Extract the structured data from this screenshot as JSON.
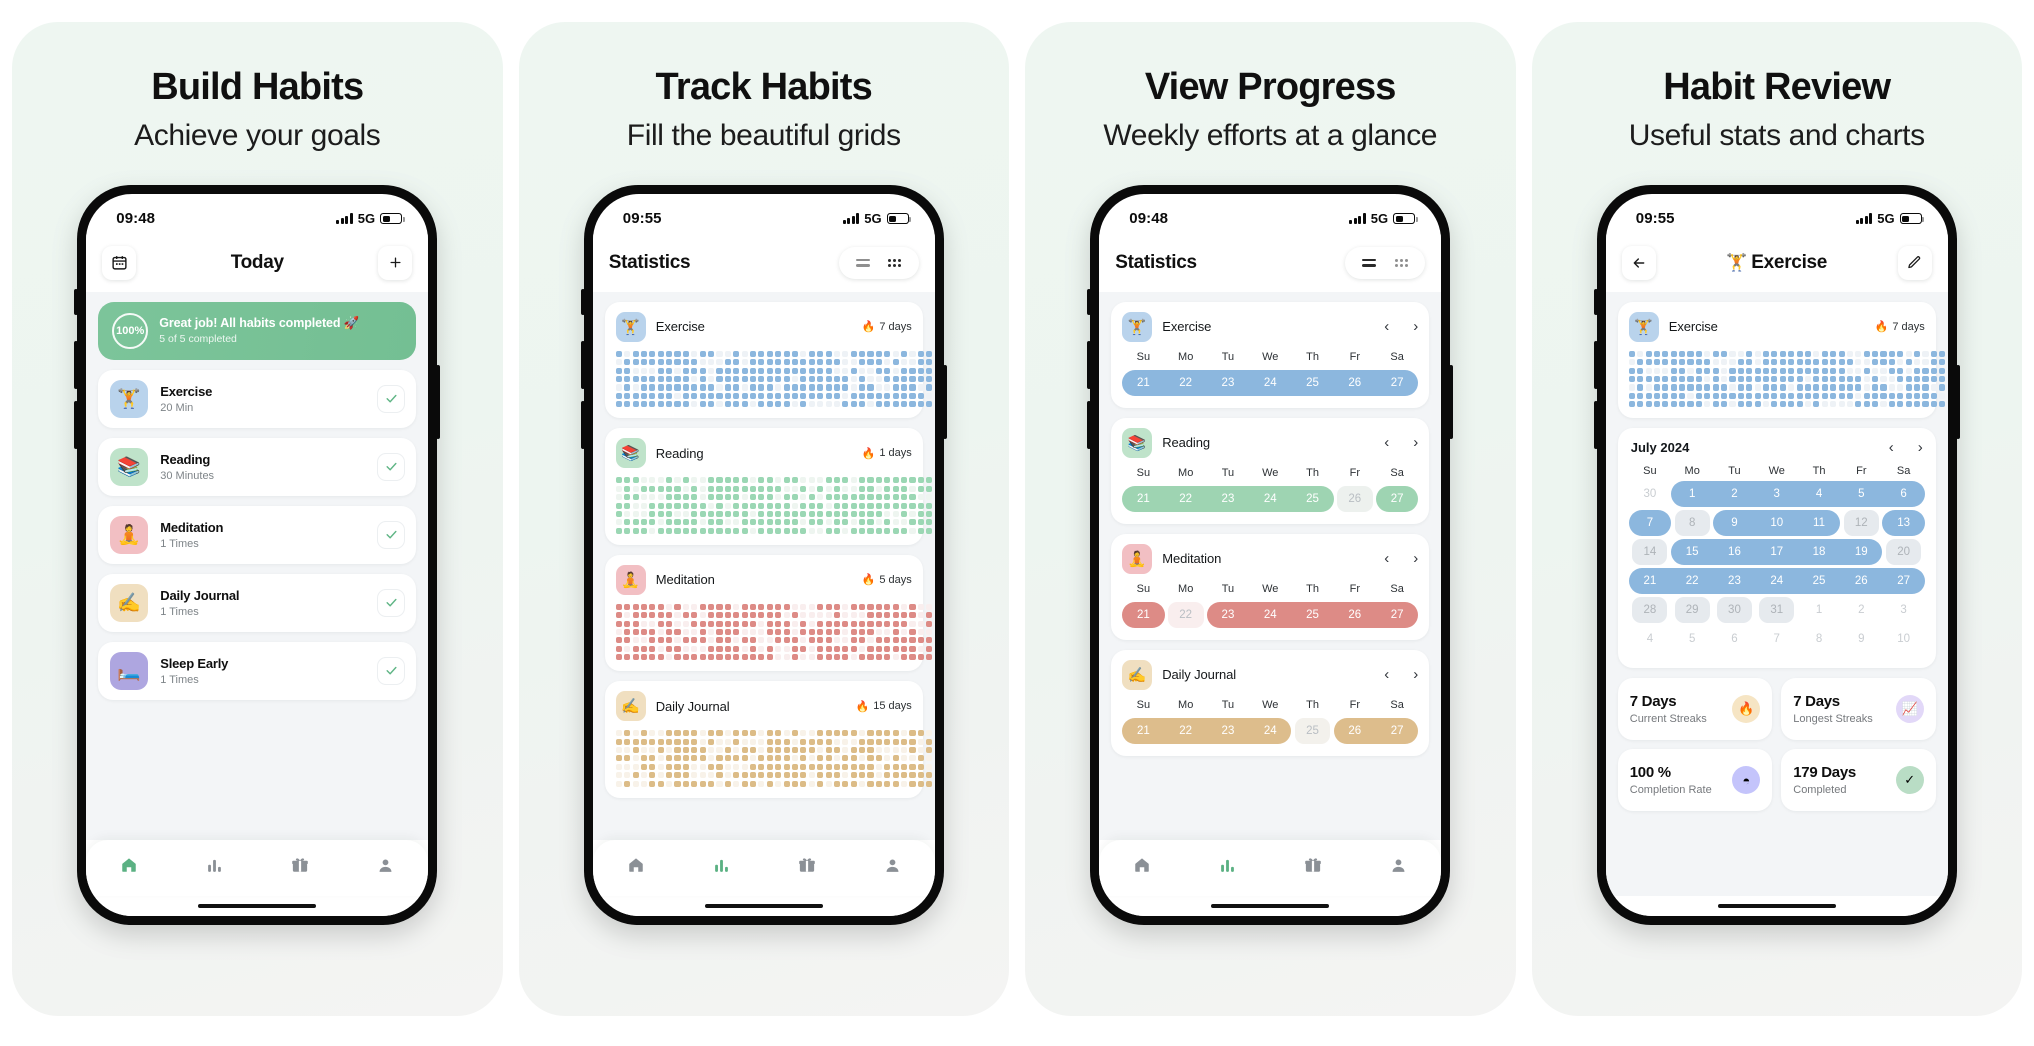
{
  "panels": [
    {
      "title": "Build Habits",
      "subtitle": "Achieve your goals"
    },
    {
      "title": "Track Habits",
      "subtitle": "Fill the beautiful grids"
    },
    {
      "title": "View Progress",
      "subtitle": "Weekly efforts at a glance"
    },
    {
      "title": "Habit Review",
      "subtitle": "Useful stats and charts"
    }
  ],
  "status": [
    {
      "time": "09:48",
      "network": "5G"
    },
    {
      "time": "09:55",
      "network": "5G"
    },
    {
      "time": "09:48",
      "network": "5G"
    },
    {
      "time": "09:55",
      "network": "5G"
    }
  ],
  "screen1": {
    "nav": {
      "title": "Today",
      "calendar_icon": "calendar-icon",
      "add_label": "+"
    },
    "summary": {
      "percent": "100%",
      "headline": "Great job! All habits completed 🚀",
      "sub": "5 of 5 completed"
    },
    "habits": [
      {
        "name": "Exercise",
        "goal": "20 Min",
        "emoji": "🏋️",
        "color": "#b9d3ec",
        "done": true
      },
      {
        "name": "Reading",
        "goal": "30 Minutes",
        "emoji": "📚",
        "color": "#bfe3ca",
        "done": true
      },
      {
        "name": "Meditation",
        "goal": "1 Times",
        "emoji": "🧘",
        "color": "#f2bfc3",
        "done": true
      },
      {
        "name": "Daily Journal",
        "goal": "1 Times",
        "emoji": "✍️",
        "color": "#f0dfc0",
        "done": true
      },
      {
        "name": "Sleep Early",
        "goal": "1 Times",
        "emoji": "🛏️",
        "color": "#aea6e0",
        "done": true
      }
    ],
    "tabs": [
      {
        "name": "home",
        "icon": "home-icon",
        "active": true
      },
      {
        "name": "stats",
        "icon": "chart-icon",
        "active": false
      },
      {
        "name": "rewards",
        "icon": "gift-icon",
        "active": false
      },
      {
        "name": "profile",
        "icon": "person-icon",
        "active": false
      }
    ]
  },
  "screen2": {
    "nav": {
      "title": "Statistics",
      "view_list": "list-view-icon",
      "view_grid": "grid-view-icon",
      "active_view": "grid"
    },
    "cards": [
      {
        "name": "Exercise",
        "emoji": "🏋️",
        "color": "#b9d3ec",
        "streak": "7 days",
        "fire": "🔥",
        "dot": "#8cb7de",
        "dim": "#eef2f6"
      },
      {
        "name": "Reading",
        "emoji": "📚",
        "color": "#bfe3ca",
        "streak": "1 days",
        "fire": "🔥",
        "dot": "#9bd7b4",
        "dim": "#eef5f0"
      },
      {
        "name": "Meditation",
        "emoji": "🧘",
        "color": "#f2bfc3",
        "streak": "5 days",
        "fire": "🔥",
        "dot": "#dd8b86",
        "dim": "#f9eeee"
      },
      {
        "name": "Daily Journal",
        "emoji": "✍️",
        "color": "#f0dfc0",
        "streak": "15 days",
        "fire": "🔥",
        "dot": "#dcbc87",
        "dim": "#f8f2e9"
      }
    ],
    "tabs": [
      {
        "name": "home",
        "icon": "home-icon",
        "active": false
      },
      {
        "name": "stats",
        "icon": "chart-icon",
        "active": true
      },
      {
        "name": "rewards",
        "icon": "gift-icon",
        "active": false
      },
      {
        "name": "profile",
        "icon": "person-icon",
        "active": false
      }
    ]
  },
  "screen3": {
    "nav": {
      "title": "Statistics",
      "view_list": "list-view-icon",
      "view_grid": "grid-view-icon",
      "active_view": "list"
    },
    "weekday_labels": [
      "Su",
      "Mo",
      "Tu",
      "We",
      "Th",
      "Fr",
      "Sa"
    ],
    "prev_label": "‹",
    "next_label": "›",
    "weeks": [
      {
        "name": "Exercise",
        "emoji": "🏋️",
        "color": "#b9d3ec",
        "fill": "#8cb7de",
        "faint": "#eef1f4",
        "days": [
          "21",
          "22",
          "23",
          "24",
          "25",
          "26",
          "27"
        ],
        "runs": [
          [
            0,
            6
          ]
        ],
        "faded": []
      },
      {
        "name": "Reading",
        "emoji": "📚",
        "color": "#bfe3ca",
        "fill": "#9ed4b2",
        "faint": "#edf1ee",
        "days": [
          "21",
          "22",
          "23",
          "24",
          "25",
          "26",
          "27"
        ],
        "runs": [
          [
            0,
            4
          ],
          [
            6,
            6
          ]
        ],
        "faded": [
          5
        ]
      },
      {
        "name": "Meditation",
        "emoji": "🧘",
        "color": "#f2bfc3",
        "fill": "#dd8b86",
        "faint": "#f9eeee",
        "days": [
          "21",
          "22",
          "23",
          "24",
          "25",
          "26",
          "27"
        ],
        "runs": [
          [
            0,
            0
          ],
          [
            2,
            6
          ]
        ],
        "faded": [
          1
        ]
      },
      {
        "name": "Daily Journal",
        "emoji": "✍️",
        "color": "#f0dfc0",
        "fill": "#ddbd8c",
        "faint": "#f3f1ec",
        "days": [
          "21",
          "22",
          "23",
          "24",
          "25",
          "26",
          "27"
        ],
        "runs": [
          [
            0,
            3
          ],
          [
            5,
            6
          ]
        ],
        "faded": [
          4
        ]
      }
    ],
    "tabs": [
      {
        "name": "home",
        "icon": "home-icon",
        "active": false
      },
      {
        "name": "stats",
        "icon": "chart-icon",
        "active": true
      },
      {
        "name": "rewards",
        "icon": "gift-icon",
        "active": false
      },
      {
        "name": "profile",
        "icon": "person-icon",
        "active": false
      }
    ]
  },
  "screen4": {
    "nav": {
      "back_icon": "back-arrow-icon",
      "title": "Exercise",
      "emoji": "🏋️",
      "edit_icon": "pencil-icon"
    },
    "heat_card": {
      "name": "Exercise",
      "emoji": "🏋️",
      "color": "#b9d3ec",
      "streak": "7 days",
      "fire": "🔥",
      "dot": "#8cb7de",
      "dim": "#eef2f6"
    },
    "calendar": {
      "month": "July 2024",
      "prev_label": "‹",
      "next_label": "›",
      "weekday_labels": [
        "Su",
        "Mo",
        "Tu",
        "We",
        "Th",
        "Fr",
        "Sa"
      ],
      "fill": "#8cb7de",
      "faint": "#e6eaee",
      "weeks": [
        {
          "days": [
            "30",
            "1",
            "2",
            "3",
            "4",
            "5",
            "6"
          ],
          "muted": [
            0
          ],
          "runs": [
            [
              1,
              6
            ]
          ],
          "faded": []
        },
        {
          "days": [
            "7",
            "8",
            "9",
            "10",
            "11",
            "12",
            "13"
          ],
          "muted": [],
          "runs": [
            [
              0,
              0
            ],
            [
              2,
              4
            ],
            [
              6,
              6
            ]
          ],
          "faded": [
            1,
            5
          ]
        },
        {
          "days": [
            "14",
            "15",
            "16",
            "17",
            "18",
            "19",
            "20"
          ],
          "muted": [],
          "runs": [
            [
              1,
              5
            ]
          ],
          "faded": [
            0,
            6
          ]
        },
        {
          "days": [
            "21",
            "22",
            "23",
            "24",
            "25",
            "26",
            "27"
          ],
          "muted": [],
          "runs": [
            [
              0,
              6
            ]
          ],
          "faded": []
        },
        {
          "days": [
            "28",
            "29",
            "30",
            "31",
            "1",
            "2",
            "3"
          ],
          "muted": [
            4,
            5,
            6
          ],
          "runs": [],
          "faded": [
            0,
            1,
            2,
            3
          ]
        },
        {
          "days": [
            "4",
            "5",
            "6",
            "7",
            "8",
            "9",
            "10"
          ],
          "muted": [
            0,
            1,
            2,
            3,
            4,
            5,
            6
          ],
          "runs": [],
          "faded": []
        }
      ]
    },
    "tiles": [
      {
        "value": "7 Days",
        "label": "Current Streaks",
        "icon": "flame-icon",
        "glyph": "🔥",
        "bg": "#f6e5c4"
      },
      {
        "value": "7 Days",
        "label": "Longest Streaks",
        "icon": "trendline-icon",
        "glyph": "📈",
        "bg": "#e2d8f8"
      },
      {
        "value": "100 %",
        "label": "Completion Rate",
        "icon": "piechart-icon",
        "glyph": "◓",
        "bg": "#c4c4fb"
      },
      {
        "value": "179 Days",
        "label": "Completed",
        "icon": "check-icon",
        "glyph": "✓",
        "bg": "#b9ddc5"
      }
    ]
  }
}
